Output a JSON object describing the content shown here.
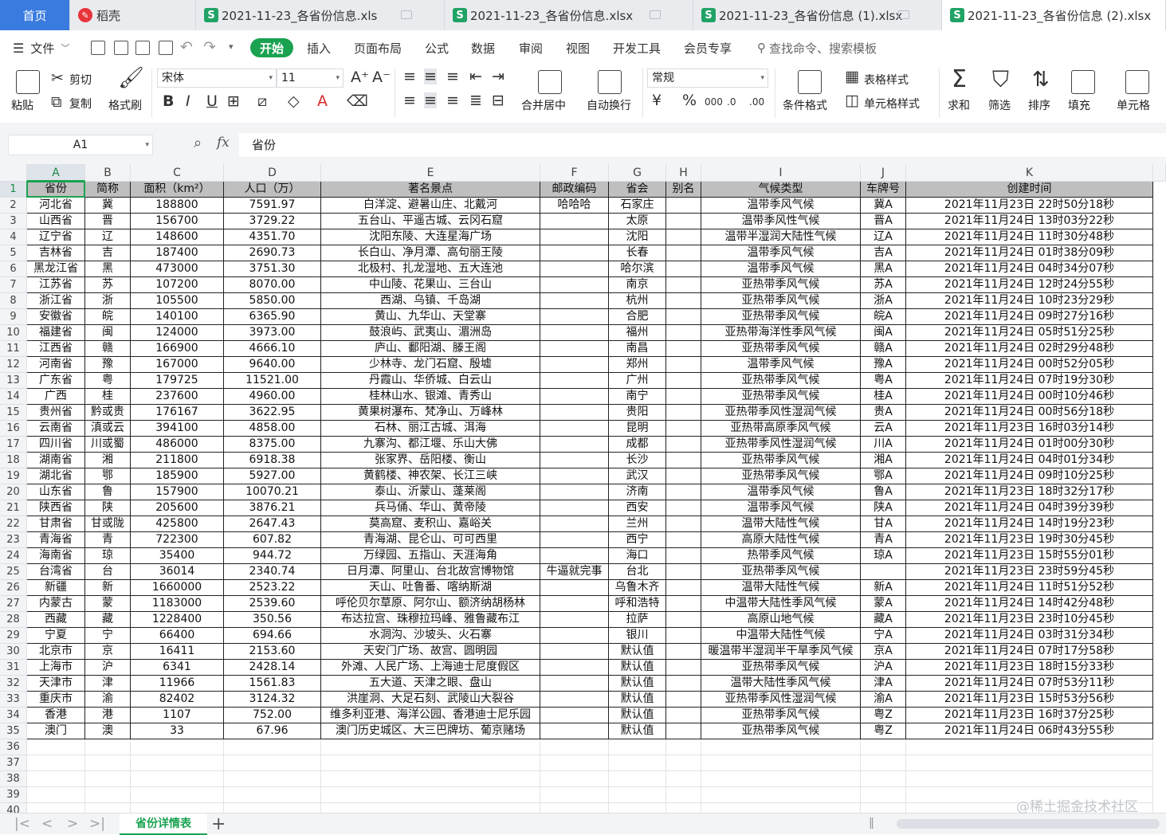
{
  "tabs": [
    {
      "label": "首页",
      "kind": "home"
    },
    {
      "label": "稻壳",
      "kind": "docer"
    },
    {
      "label": "2021-11-23_各省份信息.xls",
      "kind": "sheet"
    },
    {
      "label": "2021-11-23_各省份信息.xlsx",
      "kind": "sheet"
    },
    {
      "label": "2021-11-23_各省份信息 (1).xlsx",
      "kind": "sheet"
    },
    {
      "label": "2021-11-23_各省份信息 (2).xlsx",
      "kind": "sheet",
      "active": true
    }
  ],
  "menu": {
    "file": "文件",
    "items": [
      "开始",
      "插入",
      "页面布局",
      "公式",
      "数据",
      "审阅",
      "视图",
      "开发工具",
      "会员专享"
    ],
    "active": "开始",
    "search_placeholder": "查找命令、搜索模板"
  },
  "ribbon": {
    "paste": "粘贴",
    "cut": "剪切",
    "copy": "复制",
    "format_painter": "格式刷",
    "font_name": "宋体",
    "font_size": "11",
    "merge_center": "合并居中",
    "wrap_text": "自动换行",
    "number_format": "常规",
    "cond_format": "条件格式",
    "table_style": "表格样式",
    "cell_style": "单元格样式",
    "sum": "求和",
    "filter": "筛选",
    "sort": "排序",
    "fill": "填充",
    "cell": "单元格"
  },
  "formula_bar": {
    "name_box": "A1",
    "fx": "fx",
    "content": "省份"
  },
  "columns": [
    "A",
    "B",
    "C",
    "D",
    "E",
    "F",
    "G",
    "H",
    "I",
    "J",
    "K"
  ],
  "header_row": [
    "省份",
    "简称",
    "面积（km²）",
    "人口（万）",
    "著名景点",
    "邮政编码",
    "省会",
    "别名",
    "气候类型",
    "车牌号",
    "创建时间"
  ],
  "rows": [
    [
      "河北省",
      "冀",
      "188800",
      "7591.97",
      "白洋淀、避暑山庄、北戴河",
      "哈哈哈",
      "石家庄",
      "",
      "温带季风气候",
      "冀A",
      "2021年11月23日  22时50分18秒"
    ],
    [
      "山西省",
      "晋",
      "156700",
      "3729.22",
      "五台山、平遥古城、云冈石窟",
      "",
      "太原",
      "",
      "温带季风性气候",
      "晋A",
      "2021年11月24日  13时03分22秒"
    ],
    [
      "辽宁省",
      "辽",
      "148600",
      "4351.70",
      "沈阳东陵、大连星海广场",
      "",
      "沈阳",
      "",
      "温带半湿润大陆性气候",
      "辽A",
      "2021年11月24日  11时30分48秒"
    ],
    [
      "吉林省",
      "吉",
      "187400",
      "2690.73",
      "长白山、净月潭、高句丽王陵",
      "",
      "长春",
      "",
      "温带季风气候",
      "吉A",
      "2021年11月24日  01时38分09秒"
    ],
    [
      "黑龙江省",
      "黑",
      "473000",
      "3751.30",
      "北极村、扎龙湿地、五大连池",
      "",
      "哈尔滨",
      "",
      "温带季风气候",
      "黑A",
      "2021年11月24日  04时34分07秒"
    ],
    [
      "江苏省",
      "苏",
      "107200",
      "8070.00",
      "中山陵、花果山、三台山",
      "",
      "南京",
      "",
      "亚热带季风气候",
      "苏A",
      "2021年11月24日  12时24分55秒"
    ],
    [
      "浙江省",
      "浙",
      "105500",
      "5850.00",
      "西湖、乌镇、千岛湖",
      "",
      "杭州",
      "",
      "亚热带季风气候",
      "浙A",
      "2021年11月24日  10时23分29秒"
    ],
    [
      "安徽省",
      "皖",
      "140100",
      "6365.90",
      "黄山、九华山、天堂寨",
      "",
      "合肥",
      "",
      "亚热带季风气候",
      "皖A",
      "2021年11月24日  09时27分16秒"
    ],
    [
      "福建省",
      "闽",
      "124000",
      "3973.00",
      "鼓浪屿、武夷山、湄洲岛",
      "",
      "福州",
      "",
      "亚热带海洋性季风气候",
      "闽A",
      "2021年11月24日  05时51分25秒"
    ],
    [
      "江西省",
      "赣",
      "166900",
      "4666.10",
      "庐山、鄱阳湖、滕王阁",
      "",
      "南昌",
      "",
      "亚热带季风气候",
      "赣A",
      "2021年11月24日  02时29分48秒"
    ],
    [
      "河南省",
      "豫",
      "167000",
      "9640.00",
      "少林寺、龙门石窟、殷墟",
      "",
      "郑州",
      "",
      "温带季风气候",
      "豫A",
      "2021年11月24日  00时52分05秒"
    ],
    [
      "广东省",
      "粤",
      "179725",
      "11521.00",
      "丹霞山、华侨城、白云山",
      "",
      "广州",
      "",
      "亚热带季风气候",
      "粤A",
      "2021年11月24日  07时19分30秒"
    ],
    [
      "广西",
      "桂",
      "237600",
      "4960.00",
      "桂林山水、银滩、青秀山",
      "",
      "南宁",
      "",
      "亚热带季风气候",
      "桂A",
      "2021年11月24日  00时10分46秒"
    ],
    [
      "贵州省",
      "黔或贵",
      "176167",
      "3622.95",
      "黄果树瀑布、梵净山、万峰林",
      "",
      "贵阳",
      "",
      "亚热带季风性湿润气候",
      "贵A",
      "2021年11月24日  00时56分18秒"
    ],
    [
      "云南省",
      "滇或云",
      "394100",
      "4858.00",
      "石林、丽江古城、洱海",
      "",
      "昆明",
      "",
      "亚热带高原季风气候",
      "云A",
      "2021年11月23日  16时03分14秒"
    ],
    [
      "四川省",
      "川或蜀",
      "486000",
      "8375.00",
      "九寨沟、都江堰、乐山大佛",
      "",
      "成都",
      "",
      "亚热带季风性湿润气候",
      "川A",
      "2021年11月24日  01时00分30秒"
    ],
    [
      "湖南省",
      "湘",
      "211800",
      "6918.38",
      "张家界、岳阳楼、衡山",
      "",
      "长沙",
      "",
      "亚热带季风气候",
      "湘A",
      "2021年11月24日  04时01分34秒"
    ],
    [
      "湖北省",
      "鄂",
      "185900",
      "5927.00",
      "黄鹤楼、神农架、长江三峡",
      "",
      "武汉",
      "",
      "亚热带季风气候",
      "鄂A",
      "2021年11月24日  09时10分25秒"
    ],
    [
      "山东省",
      "鲁",
      "157900",
      "10070.21",
      "泰山、沂蒙山、蓬莱阁",
      "",
      "济南",
      "",
      "温带季风气候",
      "鲁A",
      "2021年11月23日  18时32分17秒"
    ],
    [
      "陕西省",
      "陕",
      "205600",
      "3876.21",
      "兵马俑、华山、黄帝陵",
      "",
      "西安",
      "",
      "温带季风气候",
      "陕A",
      "2021年11月24日  04时39分39秒"
    ],
    [
      "甘肃省",
      "甘或陇",
      "425800",
      "2647.43",
      "莫高窟、麦积山、嘉峪关",
      "",
      "兰州",
      "",
      "温带大陆性气候",
      "甘A",
      "2021年11月24日  14时19分23秒"
    ],
    [
      "青海省",
      "青",
      "722300",
      "607.82",
      "青海湖、昆仑山、可可西里",
      "",
      "西宁",
      "",
      "高原大陆性气候",
      "青A",
      "2021年11月23日  19时30分45秒"
    ],
    [
      "海南省",
      "琼",
      "35400",
      "944.72",
      "万绿园、五指山、天涯海角",
      "",
      "海口",
      "",
      "热带季风气候",
      "琼A",
      "2021年11月23日  15时55分01秒"
    ],
    [
      "台湾省",
      "台",
      "36014",
      "2340.74",
      "日月潭、阿里山、台北故宫博物馆",
      "牛逼就完事",
      "台北",
      "",
      "亚热带季风气候",
      "",
      "2021年11月23日  23时59分45秒"
    ],
    [
      "新疆",
      "新",
      "1660000",
      "2523.22",
      "天山、吐鲁番、喀纳斯湖",
      "",
      "乌鲁木齐",
      "",
      "温带大陆性气候",
      "新A",
      "2021年11月24日  11时51分52秒"
    ],
    [
      "内蒙古",
      "蒙",
      "1183000",
      "2539.60",
      "呼伦贝尔草原、阿尔山、额济纳胡杨林",
      "",
      "呼和浩特",
      "",
      "中温带大陆性季风气候",
      "蒙A",
      "2021年11月24日  14时42分48秒"
    ],
    [
      "西藏",
      "藏",
      "1228400",
      "350.56",
      "布达拉宫、珠穆拉玛峰、雅鲁藏布江",
      "",
      "拉萨",
      "",
      "高原山地气候",
      "藏A",
      "2021年11月23日  23时10分45秒"
    ],
    [
      "宁夏",
      "宁",
      "66400",
      "694.66",
      "水洞沟、沙坡头、火石寨",
      "",
      "银川",
      "",
      "中温带大陆性气候",
      "宁A",
      "2021年11月24日  03时31分34秒"
    ],
    [
      "北京市",
      "京",
      "16411",
      "2153.60",
      "天安门广场、故宫、圆明园",
      "",
      "默认值",
      "",
      "暖温带半湿润半干旱季风气候",
      "京A",
      "2021年11月24日  07时17分58秒"
    ],
    [
      "上海市",
      "沪",
      "6341",
      "2428.14",
      "外滩、人民广场、上海迪士尼度假区",
      "",
      "默认值",
      "",
      "亚热带季风气候",
      "沪A",
      "2021年11月23日  18时15分33秒"
    ],
    [
      "天津市",
      "津",
      "11966",
      "1561.83",
      "五大道、天津之眼、盘山",
      "",
      "默认值",
      "",
      "温带大陆性季风气候",
      "津A",
      "2021年11月24日  07时53分11秒"
    ],
    [
      "重庆市",
      "渝",
      "82402",
      "3124.32",
      "洪崖洞、大足石刻、武陵山大裂谷",
      "",
      "默认值",
      "",
      "亚热带季风性湿润气候",
      "渝A",
      "2021年11月23日  15时53分56秒"
    ],
    [
      "香港",
      "港",
      "1107",
      "752.00",
      "维多利亚港、海洋公园、香港迪士尼乐园",
      "",
      "默认值",
      "",
      "亚热带季风气候",
      "粤Z",
      "2021年11月23日  16时37分25秒"
    ],
    [
      "澳门",
      "澳",
      "33",
      "67.96",
      "澳门历史城区、大三巴牌坊、葡京赌场",
      "",
      "默认值",
      "",
      "亚热带季风气候",
      "粤Z",
      "2021年11月24日  06时43分55秒"
    ]
  ],
  "empty_rows": [
    "36",
    "37",
    "38",
    "39",
    "40"
  ],
  "sheet_tab": "省份详情表",
  "watermark": "@稀土掘金技术社区",
  "colors": {
    "accent": "#1aa251",
    "header_fill": "#bfbfbf",
    "home_tab": "#3a7be0"
  }
}
